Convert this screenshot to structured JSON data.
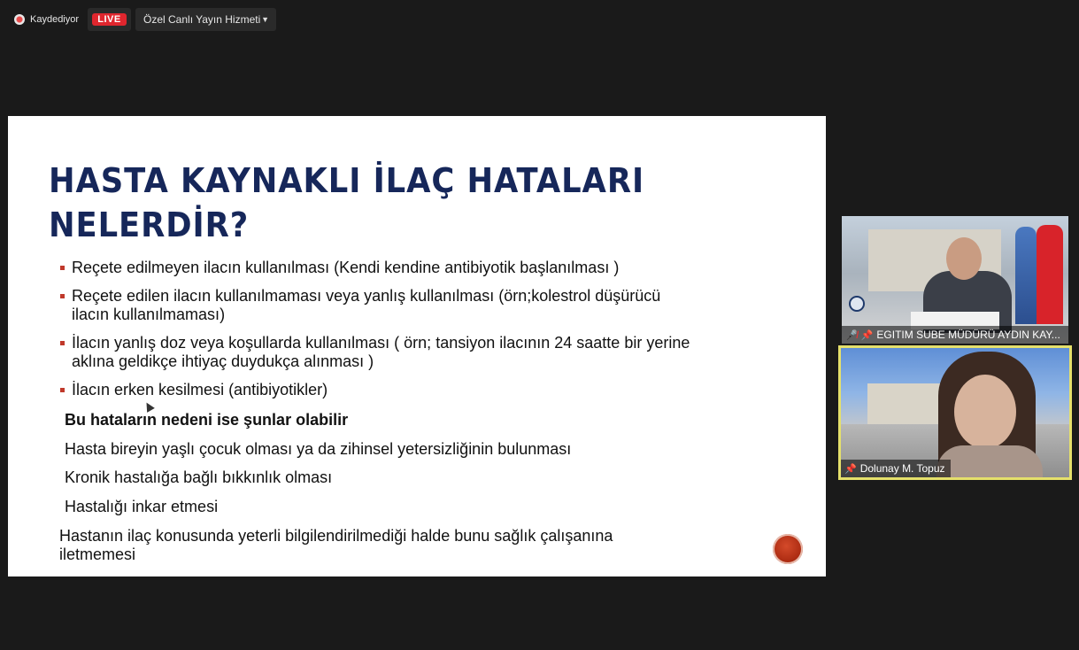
{
  "topbar": {
    "recording_label": "Kaydediyor",
    "live_label": "LIVE",
    "service_label": "Özel Canlı Yayın Hizmeti"
  },
  "slide": {
    "title_line1": "HASTA KAYNAKLI İLAÇ HATALARI",
    "title_line2": "NELERDİR?",
    "bullets": [
      {
        "line1": "Reçete edilmeyen ilacın kullanılması (Kendi kendine antibiyotik başlanılması )",
        "line2": ""
      },
      {
        "line1": "Reçete edilen ilacın kullanılmaması veya yanlış kullanılması (örn;kolestrol düşürücü",
        "line2": "ilacın kullanılmaması)"
      },
      {
        "line1": "İlacın yanlış doz veya koşullarda kullanılması ( örn; tansiyon ilacının 24 saatte bir yerine",
        "line2": "aklına geldikçe ihtiyaç duydukça alınması )"
      },
      {
        "line1": " İlacın erken kesilmesi (antibiyotikler)",
        "line2": ""
      }
    ],
    "cause_heading": "Bu hataların nedeni ise şunlar olabilir",
    "causes": [
      "Hasta bireyin yaşlı çocuk olması ya da zihinsel yetersizliğinin bulunması",
      "Kronik hastalığa bağlı bıkkınlık olması",
      "Hastalığı inkar etmesi"
    ],
    "last_cause_line1": " Hastanın ilaç konusunda yeterli bilgilendirilmediği halde bunu sağlık çalışanına",
    "last_cause_line2": "iletmemesi"
  },
  "participants": [
    {
      "name": "EGITIM SUBE MÜDÜRÜ AYDIN KAY...",
      "muted": true,
      "pinned": true
    },
    {
      "name": "Dolunay M. Topuz",
      "muted": false,
      "pinned": true
    }
  ],
  "colors": {
    "title": "#16275a",
    "bullet": "#c0392b",
    "live": "#e0262e",
    "active_speaker_border": "#e5e06b"
  }
}
